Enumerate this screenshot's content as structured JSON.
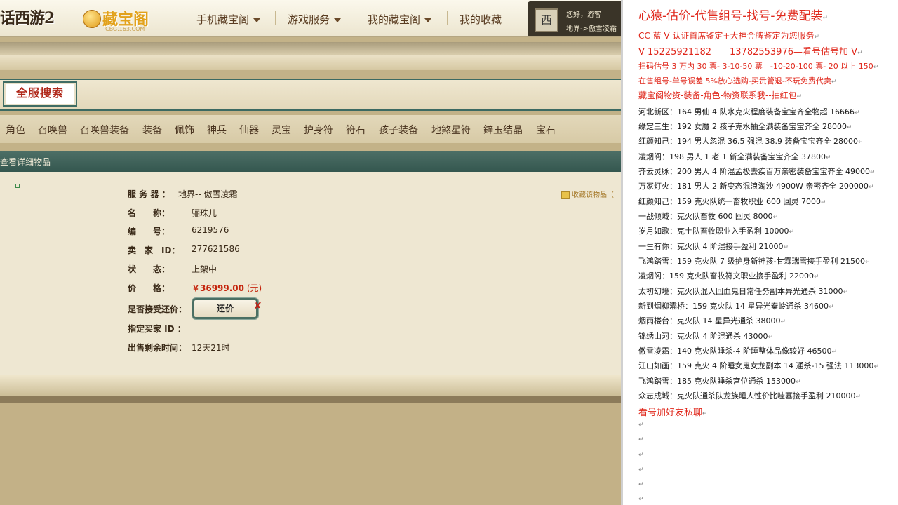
{
  "header": {
    "game_logo": "话西游2",
    "cbg_logo": "藏宝阁",
    "cbg_url": "CBG.163.COM",
    "nav": [
      {
        "label": "手机藏宝阁",
        "dropdown": true
      },
      {
        "label": "游戏服务",
        "dropdown": true
      },
      {
        "label": "我的藏宝阁",
        "dropdown": true
      },
      {
        "label": "我的收藏",
        "dropdown": false
      }
    ],
    "user": {
      "avatar_glyph": "西",
      "greeting": "您好，游客",
      "server": "地界->傲雪凌霜"
    }
  },
  "search": {
    "title": "全服搜索",
    "categories": [
      "角色",
      "召唤兽",
      "召唤兽装备",
      "装备",
      "佩饰",
      "神兵",
      "仙器",
      "灵宝",
      "护身符",
      "符石",
      "孩子装备",
      "地煞星符",
      "鋅玉结晶",
      "宝石"
    ]
  },
  "detail": {
    "header": "查看详细物品",
    "fields": {
      "server_label": "服 务 器 ：",
      "server_value": "地界-- 傲雪凌霜",
      "name_label": "名　　称：",
      "name_value": "骊珠儿",
      "id_label": "编　　号：",
      "id_value": "6219576",
      "seller_label": "卖　家　ID：",
      "seller_value": "277621586",
      "status_label": "状　　态：",
      "status_value": "上架中",
      "price_label": "价　　格：",
      "price_value": "￥36999.00",
      "price_unit": "(元)",
      "counter_label": "是否接受还价：",
      "counter_button": "还价",
      "counter_mark": "✘",
      "buyer_label": "指定买家 ID ：",
      "buyer_value": "",
      "remaining_label": "出售剩余时间：",
      "remaining_value": "12天21时"
    },
    "favorite_link": "收藏该物品（"
  },
  "notes": {
    "title": "心猿-估价-代售组号-找号-免费配装",
    "paragraph_mark": "↵",
    "promo_lines": [
      "CC 蓝 V 认证首席鉴定+大神金牌鉴定为您服务",
      "V 15225921182　　13782553976—看号估号加 V",
      "扫码估号 3 万内 30 票- 3-10-50 票　-10-20-100 票- 20 以上 150",
      "在售组号-单号误差 5%放心选购-买贵管退-不玩免费代卖",
      "藏宝阁物资-装备-角色-物资联系我--抽红包"
    ],
    "listings": [
      "河北新区：164 男仙 4 队水克火程度装备宝宝齐全物超 16666",
      "缘定三生：192 女魔 2 孩子克水抽全满装备宝宝齐全 28000",
      "红颜知己：194 男人忽混 36.5 强混 38.9 装备宝宝齐全 28000",
      "凌烟阁：198 男人 1 老 1 新全满装备宝宝齐全 37800",
      "齐云灵脉：200 男人 4 阶混孟极去疾百万亲密装备宝宝齐全 49000",
      "万家灯火：181 男人 2 新变态混浪淘沙 4900W 亲密齐全 200000",
      "红颜知己：159 克火队统一畜牧职业 600 回灵 7000",
      "一战倾城：克火队畜牧 600 回灵 8000",
      "岁月如歌：克土队畜牧职业入手盈利 10000",
      "一生有你：克火队 4 阶混接手盈利 21000",
      "飞鸿踏雪：159 克火队 7 级护身新神孩-甘霖瑞雪接手盈利 21500",
      "凌烟阁：159 克火队畜牧符文职业接手盈利 22000",
      "太初幻境：克火队混人回血鬼日常任务副本异光通杀 31000",
      "新到烟柳灞桥：159 克火队 14 星异光秦岭通杀 34600",
      "烟雨楼台：克火队 14 星异光通杀 38000",
      "锦绣山河：克火队 4 阶混通杀 43000",
      "傲雪凌霜：140 克火队睡杀-4 阶睡整体品像较好 46500",
      "江山如画：159 克火 4 阶睡女鬼女龙副本 14 通杀-15 强法 113000",
      "飞鸿踏雪：185 克火队睡杀宫位通杀 153000",
      "众志成城：克火队通杀队龙族睡人性价比哇塞接手盈利 210000"
    ],
    "closing_line": "看号加好友私聊"
  },
  "colors": {
    "accent_red": "#e0281c",
    "price_red": "#c4240c",
    "panel_teal": "#3c6a62"
  }
}
